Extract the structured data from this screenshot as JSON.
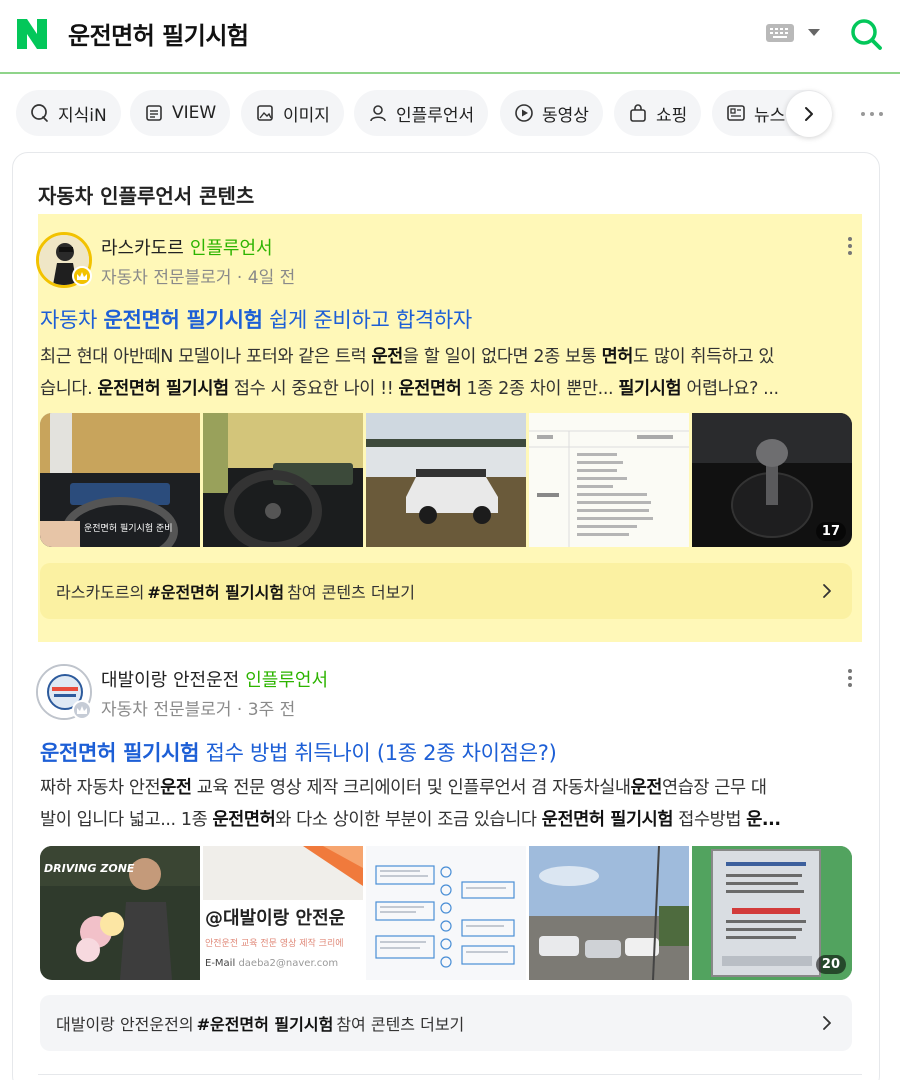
{
  "header": {
    "query": "운전면허 필기시험",
    "logo_icon": "naver-n-logo",
    "search_icon": "search-icon"
  },
  "tabs": [
    {
      "label": "지식iN",
      "icon": "search-bubble-icon"
    },
    {
      "label": "VIEW",
      "icon": "document-icon"
    },
    {
      "label": "이미지",
      "icon": "image-icon"
    },
    {
      "label": "인플루언서",
      "icon": "person-icon"
    },
    {
      "label": "동영상",
      "icon": "play-icon"
    },
    {
      "label": "쇼핑",
      "icon": "shopping-bag-icon"
    },
    {
      "label": "뉴스",
      "icon": "news-icon"
    }
  ],
  "section": {
    "title": "자동차 인플루언서 콘텐츠"
  },
  "posts": [
    {
      "author": "라스카도르",
      "badge": "인플루언서",
      "category": "자동차 전문블로거",
      "time": "4일 전",
      "title_pre": "자동차 ",
      "title_bold": "운전면허 필기시험",
      "title_post": " 쉽게 준비하고 합격하자",
      "line1": [
        {
          "t": "최근 현대 아반떼N 모델이나 포터와 같은 트럭 "
        },
        {
          "t": "운전",
          "b": true
        },
        {
          "t": "을 할 일이 없다면 2종 보통 "
        },
        {
          "t": "면허",
          "b": true
        },
        {
          "t": "도 많이 취득하고 있"
        }
      ],
      "line2": [
        {
          "t": "습니다. "
        },
        {
          "t": "운전면허 필기시험",
          "b": true
        },
        {
          "t": " 접수 시 중요한 나이 !! "
        },
        {
          "t": "운전면허",
          "b": true
        },
        {
          "t": " 1종 2종 차이 뿐만... "
        },
        {
          "t": "필기시험",
          "b": true
        },
        {
          "t": " 어렵나요? ..."
        }
      ],
      "image_count": "17",
      "thumb_caption": "운전면허 필기시험 준비",
      "more_pre": "라스카도르의 ",
      "more_tag": "#운전면허 필기시험",
      "more_post": " 참여 콘텐츠 더보기"
    },
    {
      "author": "대발이랑 안전운전",
      "badge": "인플루언서",
      "category": "자동차 전문블로거",
      "time": "3주 전",
      "title_pre": "",
      "title_bold": "운전면허 필기시험",
      "title_post": " 접수 방법 취득나이 (1종 2종 차이점은?)",
      "line1": [
        {
          "t": "짜하 자동차 안전"
        },
        {
          "t": "운전",
          "b": true
        },
        {
          "t": " 교육 전문 영상 제작 크리에이터 및 인플루언서 겸 자동차실내"
        },
        {
          "t": "운전",
          "b": true
        },
        {
          "t": "연습장 근무 대"
        }
      ],
      "line2": [
        {
          "t": "발이 입니다 넓고... 1종 "
        },
        {
          "t": "운전면허",
          "b": true
        },
        {
          "t": "와 다소 상이한 부분이 조금 있습니다 "
        },
        {
          "t": "운전면허 필기시험",
          "b": true
        },
        {
          "t": " 접수방법 "
        },
        {
          "t": "운...",
          "b": true
        }
      ],
      "image_count": "20",
      "thumb_text_1": "DRIVING ZONE",
      "thumb_text_2": "@대발이랑 안전운",
      "thumb_text_3": "안전운전 교육 전문 영상 제작 크리에",
      "thumb_email_label": "E-Mail",
      "thumb_email": "daeba2@naver.com",
      "more_pre": "대발이랑 안전운전의 ",
      "more_tag": "#운전면허 필기시험",
      "more_post": " 참여 콘텐츠 더보기"
    }
  ],
  "colors": {
    "brand_green": "#03c75a",
    "influencer_green": "#2db400",
    "link_blue": "#1d5fd6",
    "highlight": "#fff8b8"
  }
}
